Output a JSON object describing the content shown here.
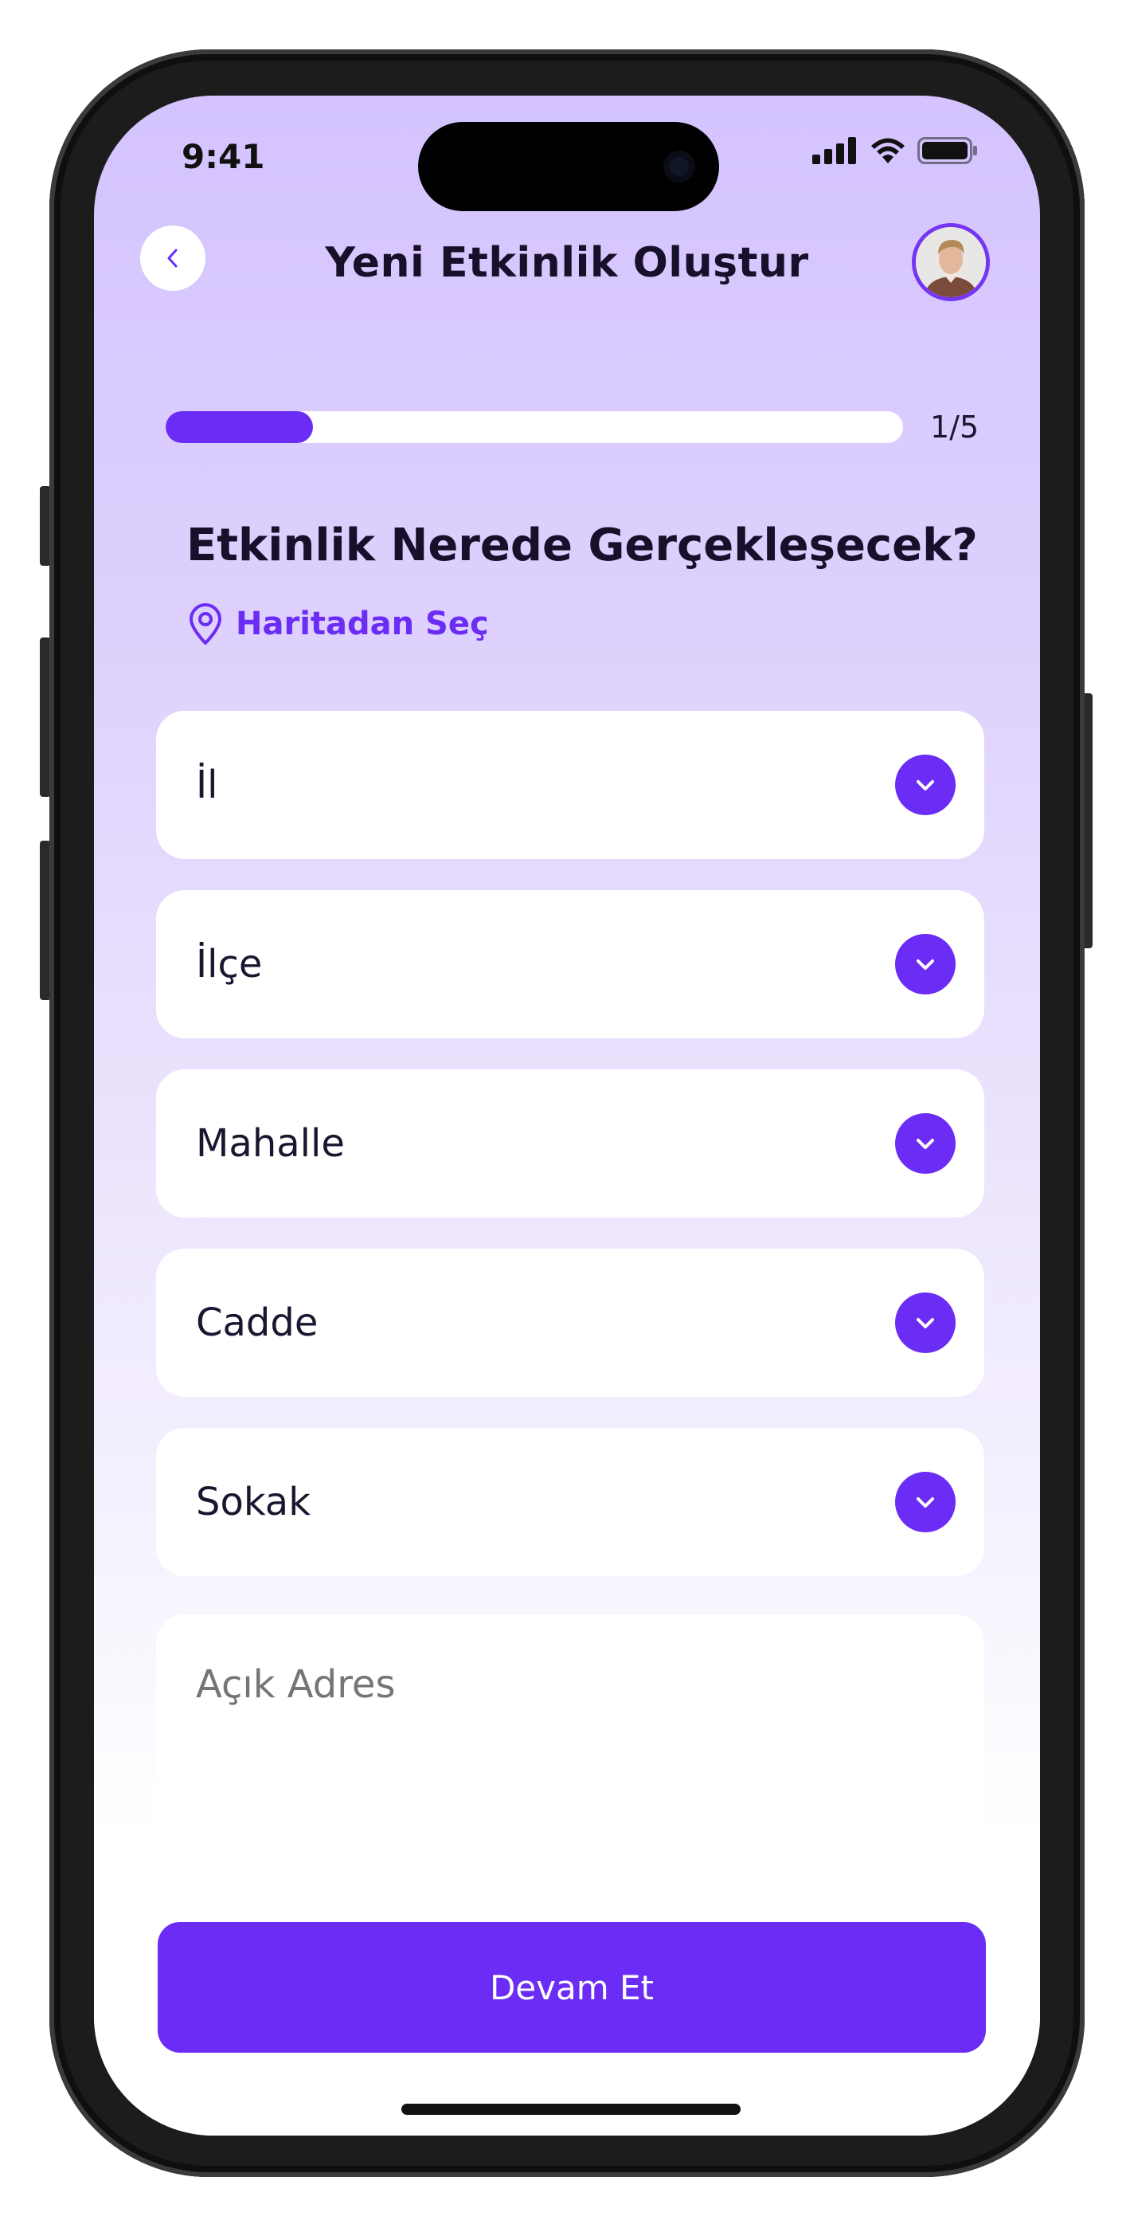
{
  "status_bar": {
    "time": "9:41"
  },
  "header": {
    "title": "Yeni Etkinlik Oluştur"
  },
  "progress": {
    "label": "1/5",
    "fraction": 0.2
  },
  "question": {
    "title": "Etkinlik Nerede Gerçekleşecek?"
  },
  "map_link": {
    "label": "Haritadan Seç"
  },
  "fields": [
    {
      "label": "İl"
    },
    {
      "label": "İlçe"
    },
    {
      "label": "Mahalle"
    },
    {
      "label": "Cadde"
    },
    {
      "label": "Sokak"
    }
  ],
  "address": {
    "placeholder": "Açık Adres",
    "value": ""
  },
  "cta": {
    "label": "Devam Et"
  },
  "colors": {
    "accent": "#6b2cf5",
    "bg_top": "#d4c3fe",
    "text": "#17102a"
  },
  "icons": {
    "back": "chevron-left-icon",
    "map": "map-pin-icon",
    "dropdown": "chevron-down-icon",
    "signal": "signal-icon",
    "wifi": "wifi-icon",
    "battery": "battery-icon"
  }
}
